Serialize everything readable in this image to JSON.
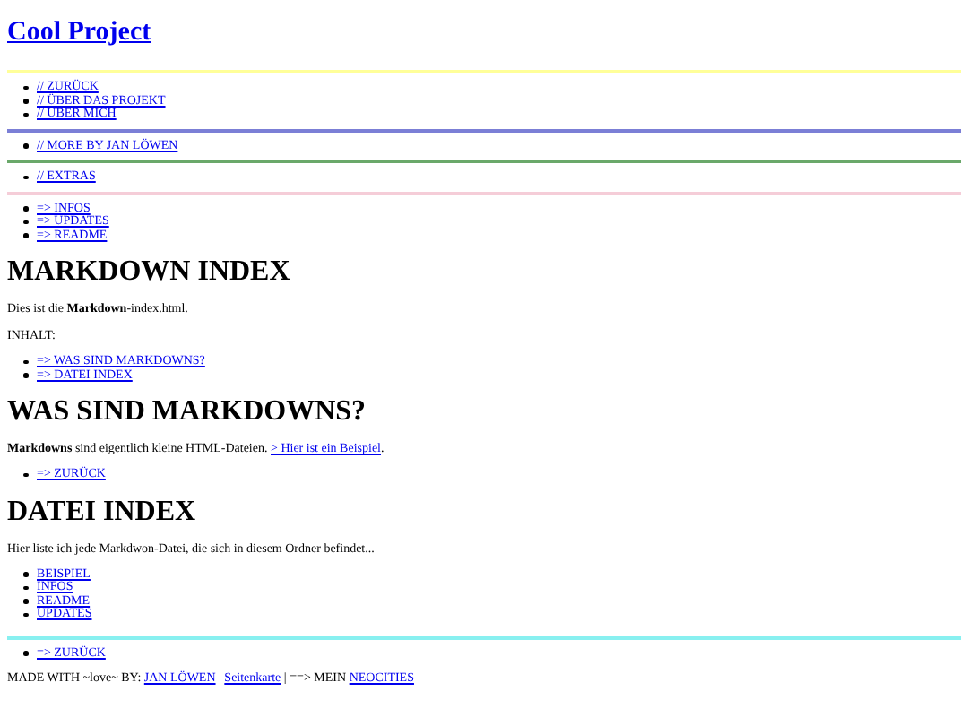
{
  "title": "Cool Project",
  "nav_groups": [
    {
      "color": "#ffff99",
      "links": [
        "// ZURÜCK",
        "// ÜBER DAS PROJEKT",
        "// ÜBER MICH"
      ]
    },
    {
      "color": "#7b7fd6",
      "links": [
        "// MORE BY JAN LÖWEN"
      ]
    },
    {
      "color": "#6aa86a",
      "links": [
        "// EXTRAS"
      ]
    },
    {
      "color": "#f5cdd8",
      "links": [
        "=> INFOS",
        "=> UPDATES",
        "=> README"
      ]
    }
  ],
  "sections": [
    {
      "heading": "MARKDOWN INDEX",
      "paragraphs": [
        {
          "text": "Dies ist die **Markdown**-index.html."
        },
        {
          "text": "INHALT:"
        }
      ],
      "links": [
        "=> WAS SIND MARKDOWNS?",
        "=> DATEI INDEX"
      ]
    },
    {
      "heading": "WAS SIND MARKDOWNS?",
      "paragraphs": [
        {
          "text": "**Markdowns** sind eigentlich kleine HTML-Dateien.",
          "link": "> Hier ist ein Beispiel",
          "after": "."
        }
      ],
      "links": [
        "=> ZURÜCK"
      ]
    },
    {
      "heading": "DATEI INDEX",
      "paragraphs": [
        {
          "text": "Hier liste ich jede Markdwon-Datei, die sich in diesem Ordner befindet..."
        }
      ],
      "links": [
        "BEISPIEL",
        "INFOS",
        "README",
        "UPDATES"
      ]
    }
  ],
  "bottom": {
    "color": "#88f0f0",
    "links": [
      "=> ZURÜCK"
    ]
  },
  "footer": [
    {
      "kind": "text",
      "text": "MADE WITH ~love~ BY:"
    },
    {
      "kind": "link",
      "text": "JAN LÖWEN"
    },
    {
      "kind": "text",
      "text": "|"
    },
    {
      "kind": "link",
      "text": "Seitenkarte"
    },
    {
      "kind": "text",
      "text": "| ==> MEIN"
    },
    {
      "kind": "link",
      "text": "NEOCITIES"
    }
  ]
}
